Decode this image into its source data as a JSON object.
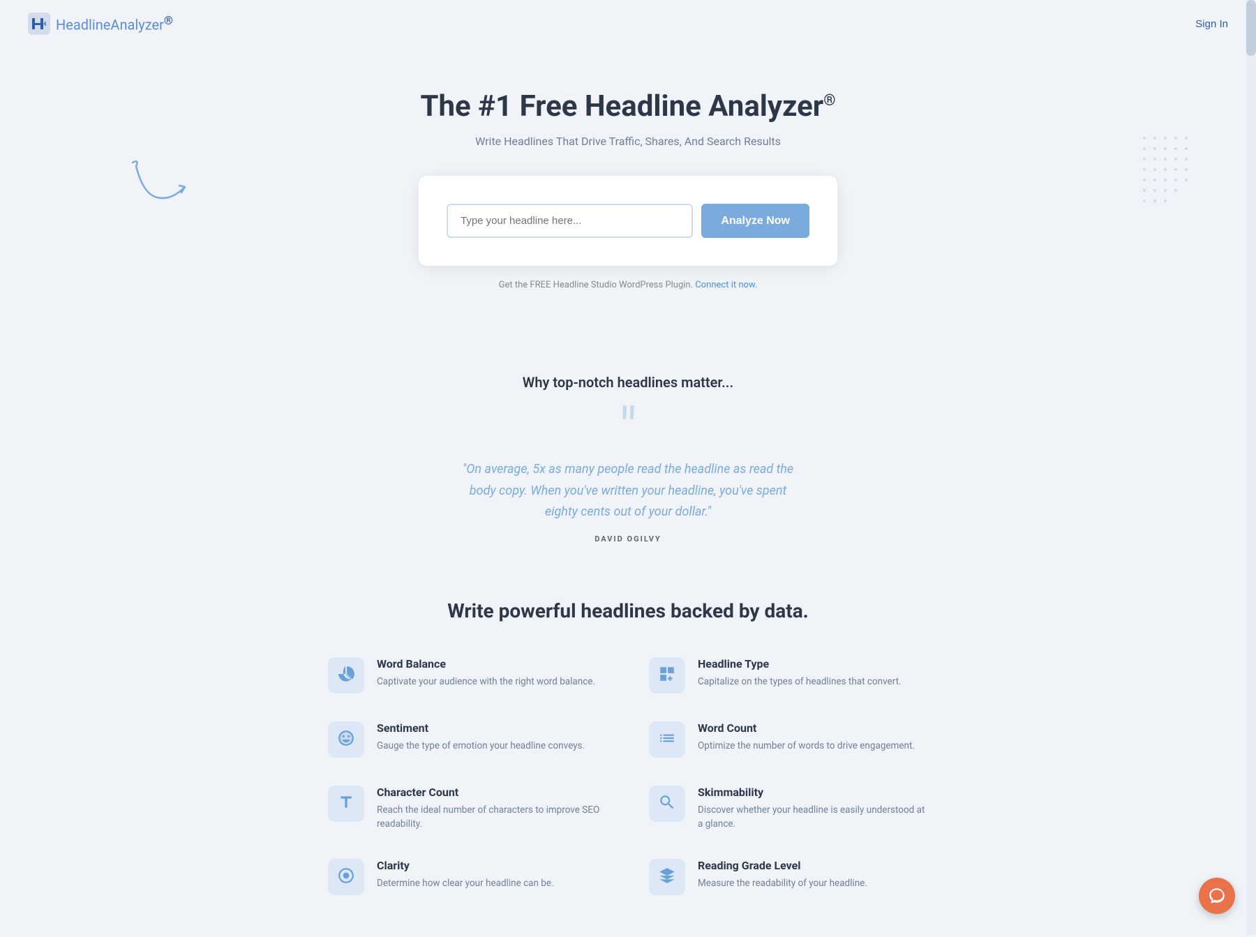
{
  "header": {
    "logo_text_main": "Headline",
    "logo_text_sub": "Analyzer",
    "logo_registered": "®",
    "sign_in_label": "Sign In"
  },
  "hero": {
    "title": "The #1 Free Headline Analyzer",
    "registered": "®",
    "subtitle": "Write Headlines That Drive Traffic, Shares, And Search Results",
    "input_placeholder": "Type your headline here...",
    "analyze_button": "Analyze Now",
    "plugin_note_prefix": "Get the FREE Headline Studio WordPress Plugin.",
    "plugin_note_link": "Connect it now."
  },
  "why_section": {
    "heading": "Why top-notch headlines matter...",
    "quote": "\"On average, 5x as many people read the headline as read the body copy. When you've written your headline, you've spent eighty cents out of your dollar.\"",
    "author": "DAVID OGILVY"
  },
  "features_section": {
    "heading": "Write powerful headlines backed by data.",
    "features": [
      {
        "id": "word-balance",
        "title": "Word Balance",
        "description": "Captivate your audience with the right word balance.",
        "icon": "pie"
      },
      {
        "id": "headline-type",
        "title": "Headline Type",
        "description": "Capitalize on the types of headlines that convert.",
        "icon": "layout"
      },
      {
        "id": "sentiment",
        "title": "Sentiment",
        "description": "Gauge the type of emotion your headline conveys.",
        "icon": "emoji"
      },
      {
        "id": "word-count",
        "title": "Word Count",
        "description": "Optimize the number of words to drive engagement.",
        "icon": "list"
      },
      {
        "id": "character-count",
        "title": "Character Count",
        "description": "Reach the ideal number of characters to improve SEO readability.",
        "icon": "text-t"
      },
      {
        "id": "skimmability",
        "title": "Skimmability",
        "description": "Discover whether your headline is easily understood at a glance.",
        "icon": "search"
      },
      {
        "id": "clarity",
        "title": "Clarity",
        "description": "Determine how clear your headline can be.",
        "icon": "circle-target"
      },
      {
        "id": "reading-grade",
        "title": "Reading Grade Level",
        "description": "Measure the readability of your headline.",
        "icon": "book"
      }
    ]
  }
}
